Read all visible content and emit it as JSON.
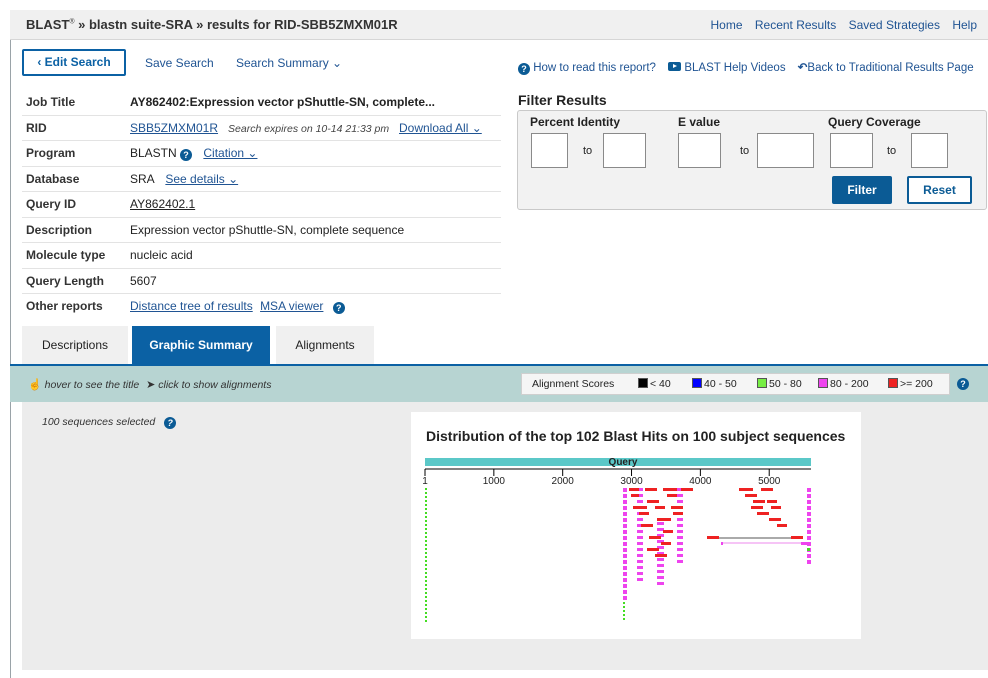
{
  "header": {
    "brand": "BLAST",
    "brand_sup": "®",
    "breadcrumb": " » blastn suite-SRA » results for RID-SBB5ZMXM01R",
    "nav": [
      "Home",
      "Recent Results",
      "Saved Strategies",
      "Help"
    ]
  },
  "actions": {
    "edit_search": "‹ Edit Search",
    "save_search": "Save Search",
    "search_summary": "Search Summary ⌄",
    "how_to_read": "How to read this report?",
    "help_videos": "BLAST Help Videos",
    "back_traditional": "Back to Traditional Results Page"
  },
  "job": {
    "title_label": "Job Title",
    "title_value": "AY862402:Expression vector pShuttle-SN, complete...",
    "rid_label": "RID",
    "rid_value": "SBB5ZMXM01R",
    "rid_expires": "Search expires on 10-14 21:33 pm",
    "download_all": "Download All ⌄",
    "program_label": "Program",
    "program_value": "BLASTN",
    "citation": "Citation ⌄",
    "database_label": "Database",
    "database_value": "SRA",
    "see_details": "See details ⌄",
    "query_id_label": "Query ID",
    "query_id_value": "AY862402.1",
    "description_label": "Description",
    "description_value": "Expression vector pShuttle-SN, complete sequence",
    "molecule_label": "Molecule type",
    "molecule_value": "nucleic acid",
    "length_label": "Query Length",
    "length_value": "5607",
    "other_label": "Other reports",
    "distance_tree": "Distance tree of results",
    "msa_viewer": "MSA viewer"
  },
  "filter": {
    "title": "Filter Results",
    "percent_identity": "Percent Identity",
    "e_value": "E value",
    "query_coverage": "Query Coverage",
    "to": "to",
    "filter_btn": "Filter",
    "reset_btn": "Reset"
  },
  "tabs": [
    "Descriptions",
    "Graphic Summary",
    "Alignments"
  ],
  "active_tab": "Graphic Summary",
  "strip": {
    "hover_hint": "hover to see the title",
    "click_hint": "click to show alignments",
    "legend_title": "Alignment Scores",
    "legend": [
      {
        "label": "< 40",
        "color": "#000000"
      },
      {
        "label": "40 - 50",
        "color": "#0000ff"
      },
      {
        "label": "50 - 80",
        "color": "#77ee44"
      },
      {
        "label": "80 - 200",
        "color": "#ee44ee"
      },
      {
        "label": ">= 200",
        "color": "#ee2222"
      }
    ]
  },
  "graphic": {
    "selected": "100 sequences selected",
    "title": "Distribution of the top 102 Blast Hits on 100 subject sequences",
    "query_label": "Query",
    "query_bar_color": "#5bc8c8",
    "ticks": [
      1,
      1000,
      2000,
      3000,
      4000,
      5000
    ],
    "query_length": 5607
  },
  "colors": {
    "accent": "#0b61a4",
    "strip": "#b7d4d2",
    "hit_red": "#ee2222",
    "hit_magenta": "#ee44ee",
    "hit_green": "#44dd22"
  }
}
